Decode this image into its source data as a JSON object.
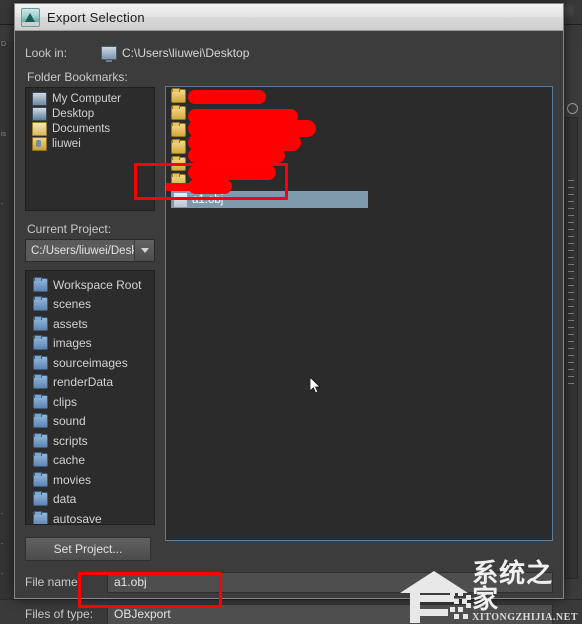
{
  "window": {
    "title": "Export Selection",
    "icon": "maya-app-icon"
  },
  "lookin": {
    "label": "Look in:",
    "path": "C:\\Users\\liuwei\\Desktop",
    "icon": "monitor-icon"
  },
  "bookmarks": {
    "label": "Folder Bookmarks:",
    "items": [
      {
        "label": "My Computer",
        "icon": "computer-icon"
      },
      {
        "label": "Desktop",
        "icon": "desktop-icon"
      },
      {
        "label": "Documents",
        "icon": "documents-folder-icon"
      },
      {
        "label": "liuwei",
        "icon": "user-folder-icon"
      }
    ]
  },
  "current_project": {
    "label": "Current Project:",
    "value": "C:/Users/liuwei/Desk",
    "dropdown_icon": "chevron-down-icon",
    "folders": [
      "Workspace Root",
      "scenes",
      "assets",
      "images",
      "sourceimages",
      "renderData",
      "clips",
      "sound",
      "scripts",
      "cache",
      "movies",
      "data",
      "autosave"
    ]
  },
  "set_project": {
    "label": "Set Project..."
  },
  "file_browser": {
    "redacted_row_count": 6,
    "selected_file": {
      "name": "a1.obj",
      "icon": "file-icon",
      "selected": true
    }
  },
  "file_name": {
    "label": "File name:",
    "value": "a1.obj"
  },
  "file_type": {
    "label": "Files of type:",
    "value": "OBJexport"
  },
  "annotations": {
    "highlight_color": "#fd0005",
    "redaction_color": "#fe0000",
    "selection_color": "#7f99ad",
    "panel_border_color": "#5c7d99"
  },
  "watermark": {
    "text": "系统之家",
    "subtext": "XITONGZHIJIA.NET"
  },
  "background": {
    "left_labels": [
      "D",
      "is",
      "-",
      "-",
      "-",
      "-"
    ]
  }
}
